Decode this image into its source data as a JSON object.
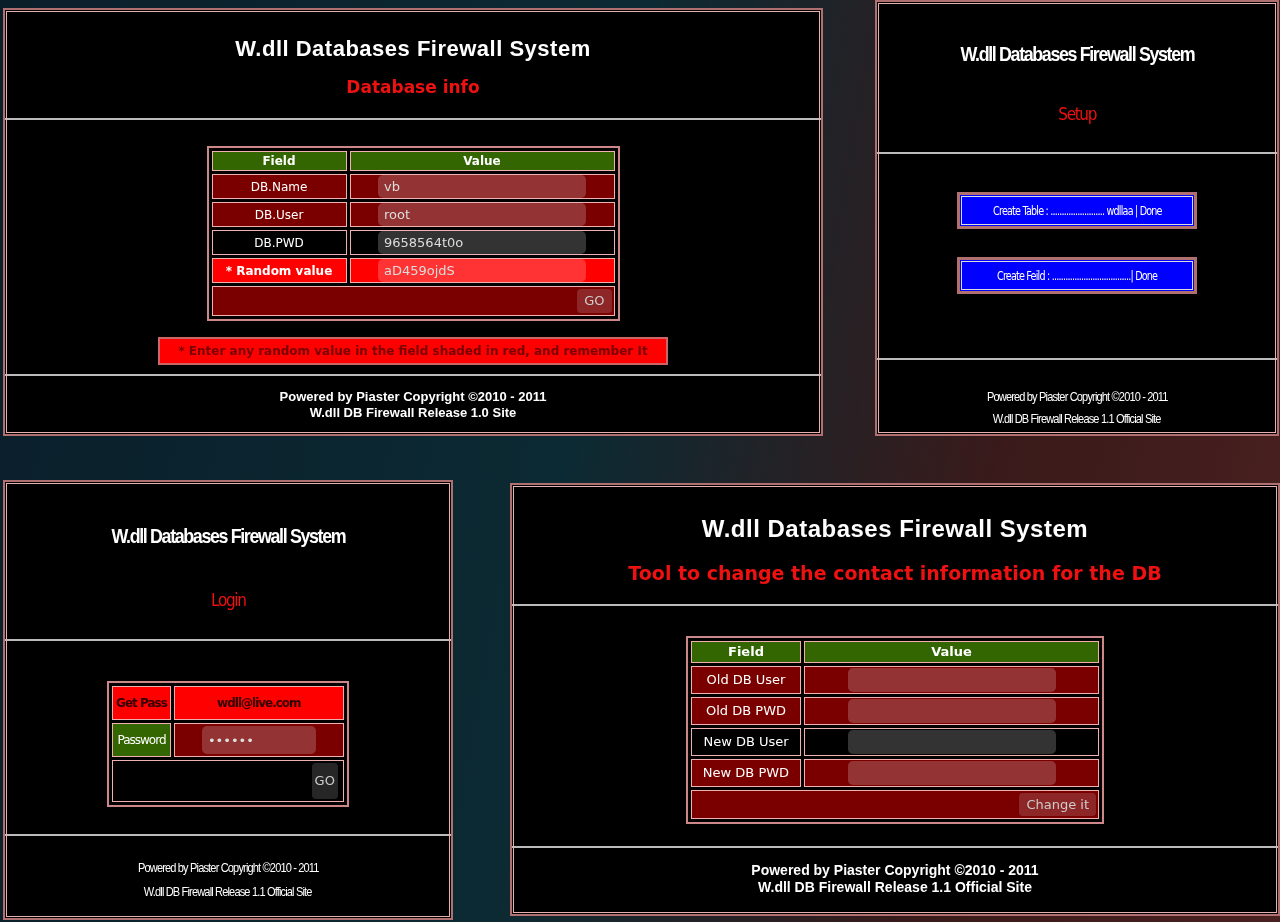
{
  "panels": [
    {
      "kind": "form",
      "title": "W.dll Databases Firewall System",
      "subtitle": "Database info",
      "columns": [
        "Field",
        "Value"
      ],
      "rows": [
        {
          "label": "DB.Name",
          "value": "vb",
          "kind": "plain"
        },
        {
          "label": "DB.User",
          "value": "root",
          "kind": "plain"
        },
        {
          "label": "DB.PWD",
          "value": "9658564t0o",
          "kind": "focused"
        },
        {
          "label": "* Random value",
          "value": "aD459ojdS",
          "kind": "required"
        }
      ],
      "button": "GO",
      "note": "* Enter any random value in the field shaded in red, and remember It",
      "footer": [
        "Powered by Piaster Copyright ©2010 - 2011",
        "W.dll DB Firewall Release 1.0 Site"
      ]
    },
    {
      "kind": "setup",
      "title": "W.dll Databases Firewall System",
      "subtitle": "Setup",
      "steps": [
        "Create Table : ........................ wdllaa | Done",
        "Create Feild : ...................................| Done"
      ],
      "footer": [
        "Powered by Piaster Copyright ©2010 - 2011",
        "W.dll DB Firewall Release 1.1 Official Site"
      ]
    },
    {
      "kind": "login",
      "title": "W.dll Databases Firewall System",
      "subtitle": "Login",
      "rows": [
        {
          "kind": "text",
          "label": "Get Pass",
          "text": "wdll@live.com"
        },
        {
          "kind": "input",
          "label": "Password",
          "value": "••••••"
        }
      ],
      "button": "GO",
      "footer": [
        "Powered by Piaster Copyright ©2010 - 2011",
        "W.dll DB Firewall Release 1.1 Official Site"
      ]
    },
    {
      "kind": "form",
      "title": "W.dll Databases Firewall System",
      "subtitle": "Tool to change the contact information for the DB",
      "columns": [
        "Field",
        "Value"
      ],
      "rows": [
        {
          "label": "Old DB User",
          "kind": "plain"
        },
        {
          "label": "Old DB PWD",
          "kind": "plain"
        },
        {
          "label": "New DB User",
          "kind": "focused"
        },
        {
          "label": "New DB PWD",
          "kind": "plain"
        }
      ],
      "button": "Change it",
      "footer": [
        "Powered by Piaster Copyright ©2010 - 2011",
        "W.dll DB Firewall Release 1.1 Official Site"
      ]
    }
  ]
}
